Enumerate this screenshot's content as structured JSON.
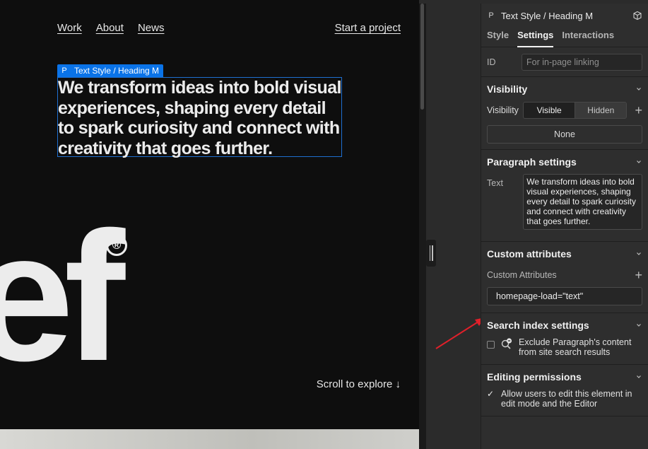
{
  "canvas": {
    "nav": [
      "Work",
      "About",
      "News"
    ],
    "cta": "Start a project",
    "selection_tag": {
      "type": "P",
      "label": "Text Style / Heading M"
    },
    "hero_text": "We transform ideas into bold visual experiences, shaping every detail to spark curiosity and connect with creativity that goes further.",
    "logo_text": "ef",
    "registered_mark": "®",
    "scroll_hint": "Scroll to explore ↓"
  },
  "panel": {
    "header": {
      "type": "P",
      "title": "Text Style / Heading M",
      "icon": "cube-icon"
    },
    "tabs": [
      {
        "label": "Style",
        "active": false
      },
      {
        "label": "Settings",
        "active": true
      },
      {
        "label": "Interactions",
        "active": false
      }
    ],
    "id_field": {
      "label": "ID",
      "placeholder": "For in-page linking",
      "value": ""
    },
    "visibility": {
      "title": "Visibility",
      "label": "Visibility",
      "options": [
        "Visible",
        "Hidden"
      ],
      "selected": "Visible",
      "condition": "None"
    },
    "paragraph": {
      "title": "Paragraph settings",
      "label": "Text",
      "value": "We transform ideas into bold visual experiences, shaping every detail to spark curiosity and connect with creativity that goes further."
    },
    "custom_attributes": {
      "title": "Custom attributes",
      "label": "Custom Attributes",
      "items": [
        "homepage-load=\"text\""
      ]
    },
    "search_index": {
      "title": "Search index settings",
      "option": "Exclude Paragraph's content from site search results",
      "checked": false
    },
    "editing": {
      "title": "Editing permissions",
      "option": "Allow users to edit this element in edit mode and the Editor",
      "checked": true
    }
  },
  "colors": {
    "accent": "#0a73e8",
    "annotation_arrow": "#e0202a",
    "canvas_bg": "#0e0e0e",
    "panel_bg": "#2e2e2e"
  }
}
